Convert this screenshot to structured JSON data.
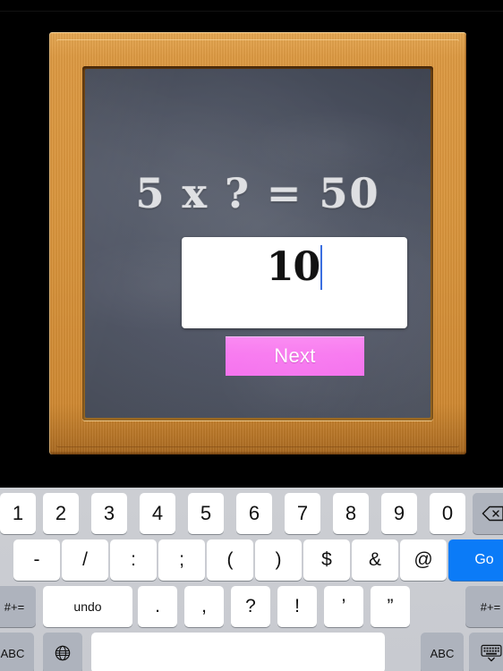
{
  "app": {
    "background_color": "#000000",
    "chalkboard_color": "#4b5160",
    "frame_color": "#d9953d",
    "accent_color": "#f87bf0"
  },
  "board": {
    "equation": "5 x ? = 50",
    "answer_value": "10",
    "next_label": "Next"
  },
  "quiz": {
    "multiplicand": "5",
    "operator": "x",
    "unknown": "?",
    "equals": "=",
    "product": "50",
    "entered_answer": "10"
  },
  "keyboard": {
    "type": "numeric-symbol",
    "rows": [
      {
        "name": "numbers",
        "keys": [
          {
            "label": "1",
            "style": "light",
            "icon": ""
          },
          {
            "label": "2",
            "style": "light",
            "icon": ""
          },
          {
            "label": "3",
            "style": "light",
            "icon": ""
          },
          {
            "label": "4",
            "style": "light",
            "icon": ""
          },
          {
            "label": "5",
            "style": "light",
            "icon": ""
          },
          {
            "label": "6",
            "style": "light",
            "icon": ""
          },
          {
            "label": "7",
            "style": "light",
            "icon": ""
          },
          {
            "label": "8",
            "style": "light",
            "icon": ""
          },
          {
            "label": "9",
            "style": "light",
            "icon": ""
          },
          {
            "label": "0",
            "style": "light",
            "icon": ""
          },
          {
            "label": "",
            "style": "dark",
            "icon": "backspace-icon"
          }
        ]
      },
      {
        "name": "symbols",
        "keys": [
          {
            "label": "-",
            "style": "light",
            "icon": ""
          },
          {
            "label": "/",
            "style": "light",
            "icon": ""
          },
          {
            "label": ":",
            "style": "light",
            "icon": ""
          },
          {
            "label": ";",
            "style": "light",
            "icon": ""
          },
          {
            "label": "(",
            "style": "light",
            "icon": ""
          },
          {
            "label": ")",
            "style": "light",
            "icon": ""
          },
          {
            "label": "$",
            "style": "light",
            "icon": ""
          },
          {
            "label": "&",
            "style": "light",
            "icon": ""
          },
          {
            "label": "@",
            "style": "light",
            "icon": ""
          },
          {
            "label": "Go",
            "style": "blue",
            "icon": ""
          }
        ]
      },
      {
        "name": "punctuation",
        "keys": [
          {
            "label": "#+=",
            "style": "dark",
            "icon": ""
          },
          {
            "label": "undo",
            "style": "light",
            "icon": ""
          },
          {
            "label": ".",
            "style": "light",
            "icon": ""
          },
          {
            "label": ",",
            "style": "light",
            "icon": ""
          },
          {
            "label": "?",
            "style": "light",
            "icon": ""
          },
          {
            "label": "!",
            "style": "light",
            "icon": ""
          },
          {
            "label": "’",
            "style": "light",
            "icon": ""
          },
          {
            "label": "”",
            "style": "light",
            "icon": ""
          },
          {
            "label": "#+=",
            "style": "dark",
            "icon": ""
          }
        ]
      },
      {
        "name": "bottom",
        "keys": [
          {
            "label": "ABC",
            "style": "dark",
            "icon": ""
          },
          {
            "label": "",
            "style": "dark",
            "icon": "globe-icon"
          },
          {
            "label": "",
            "style": "light",
            "icon": "space-key"
          },
          {
            "label": "ABC",
            "style": "dark",
            "icon": ""
          },
          {
            "label": "",
            "style": "dark",
            "icon": "hide-keyboard-icon"
          }
        ]
      }
    ]
  }
}
